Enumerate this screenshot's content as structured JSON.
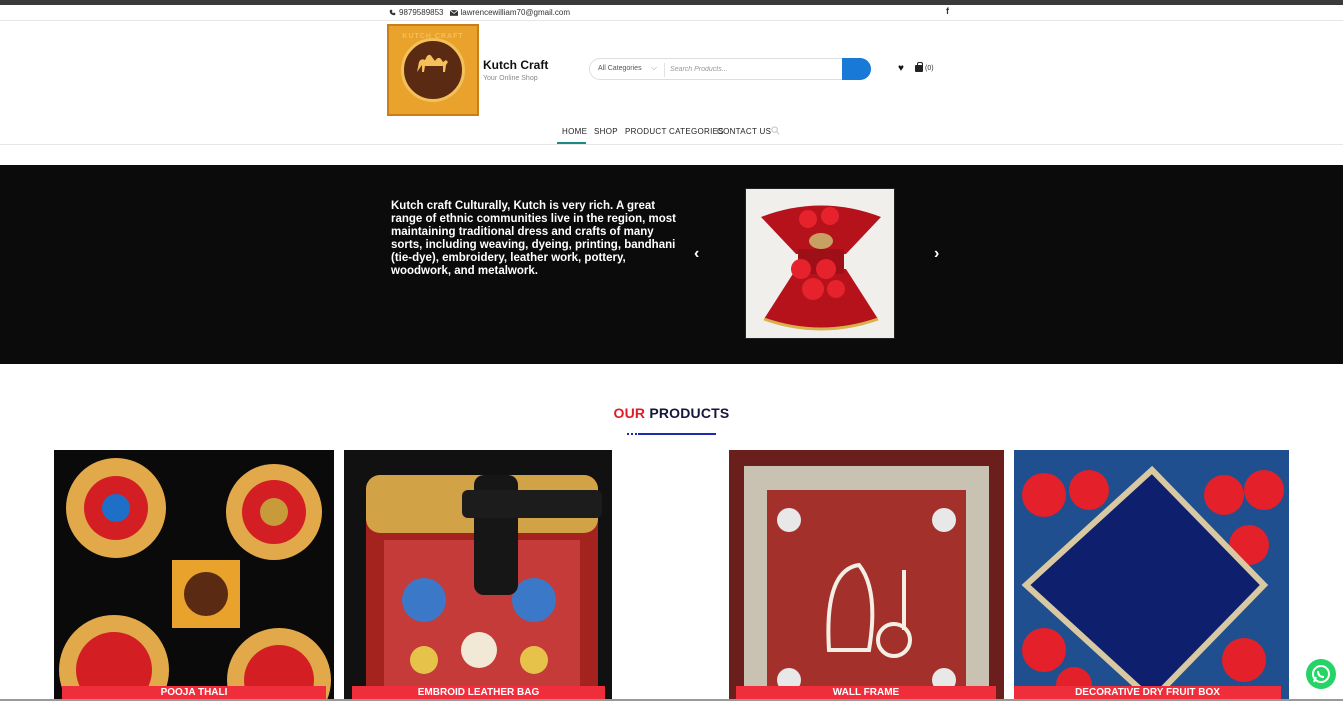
{
  "topbar": {
    "phone": "9879589853",
    "email": "lawrencewilliam70@gmail.com",
    "phone_icon": "phone-icon",
    "email_icon": "envelope-icon",
    "social_icon": "facebook-icon",
    "social_glyph": "f"
  },
  "brand": {
    "name": "Kutch Craft",
    "tagline": "Your Online Shop",
    "logo_text": "KUTCH CRAFT"
  },
  "search": {
    "category": "All Categories",
    "placeholder": "Search Products..."
  },
  "header_icons": {
    "wishlist_icon": "heart-icon",
    "cart_icon": "shopping-bag-icon",
    "cart_count": "(0)"
  },
  "nav": {
    "items": [
      "HOME",
      "SHOP",
      "PRODUCT CATEGORIES",
      "CONTACT US"
    ],
    "active": "HOME"
  },
  "hero": {
    "text": "Kutch craft Culturally, Kutch is very rich. A great range of ethnic communities live in the region, most maintaining traditional dress and crafts of many sorts, including weaving, dyeing, printing, bandhani (tie-dye), embroidery, leather work, pottery, woodwork, and metalwork.",
    "prev_glyph": "‹",
    "next_glyph": "›"
  },
  "section": {
    "title_accent": "OUR",
    "title_main": "PRODUCTS"
  },
  "products": [
    {
      "label": "POOJA THALI"
    },
    {
      "label": "EMBROID LEATHER BAG"
    },
    {
      "label": "WALL FRAME"
    },
    {
      "label": "DECORATIVE DRY FRUIT BOX"
    }
  ],
  "colors": {
    "accent_red": "#f02d3a",
    "search_button": "#1979d6",
    "nav_underline": "#1a8a88",
    "whatsapp": "#25d366"
  }
}
